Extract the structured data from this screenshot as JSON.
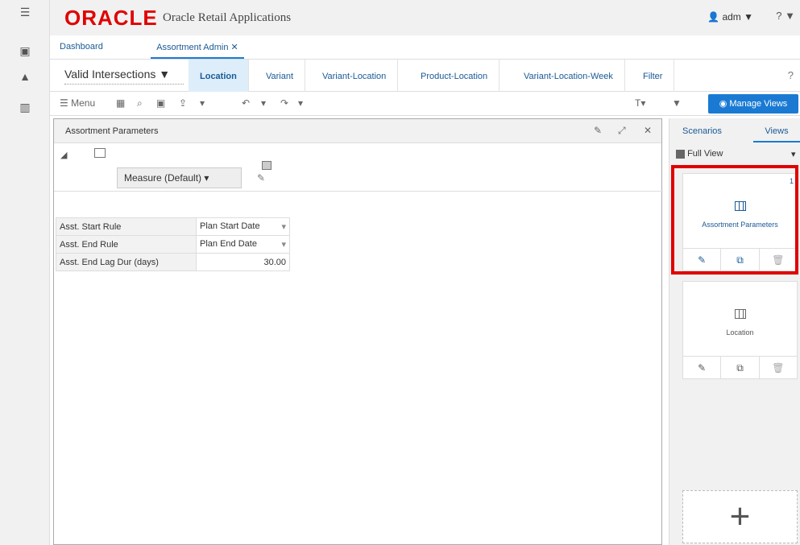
{
  "header": {
    "logo": "ORACLE",
    "app_title": "Oracle Retail Applications",
    "user": "adm ▼",
    "help": "? ▼"
  },
  "tabs": [
    {
      "label": "Dashboard"
    },
    {
      "label": "Assortment Admin",
      "close": "✕"
    }
  ],
  "intersections": {
    "selector": "Valid Intersections ▼",
    "items": [
      "Location",
      "Variant",
      "Variant-Location",
      "Product-Location",
      "Variant-Location-Week",
      "Filter"
    ],
    "active": "Location"
  },
  "toolbar": {
    "menu_label": "Menu",
    "manage_views": "Manage Views"
  },
  "panel": {
    "title": "Assortment Parameters",
    "measure": "Measure (Default)",
    "rows": [
      {
        "label": "Asst. Start Rule",
        "value": "Plan Start Date"
      },
      {
        "label": "Asst. End Rule",
        "value": "Plan End Date"
      },
      {
        "label": "Asst. End Lag Dur (days)",
        "value": "30.00"
      }
    ]
  },
  "right_panel": {
    "tabs": [
      "Scenarios",
      "Views"
    ],
    "active_tab": "Views",
    "full_view": "Full View",
    "cards": [
      {
        "number": "1",
        "name": "Assortment Parameters"
      },
      {
        "number": "",
        "name": "Location"
      }
    ]
  },
  "colors": {
    "brand": "#e10000",
    "accent": "#1a7ad3",
    "highlight": "#e00000"
  },
  "icons": [
    "menu-icon",
    "calendar-icon",
    "bell-icon",
    "bar-chart-icon",
    "user-icon",
    "help-icon",
    "search-icon",
    "export-icon",
    "undo-icon",
    "redo-icon",
    "text-size-icon",
    "filter-icon",
    "eye-icon",
    "edit-icon",
    "expand-icon",
    "close-icon",
    "copy-add-icon",
    "trash-icon",
    "grid-icon",
    "plus-icon"
  ]
}
